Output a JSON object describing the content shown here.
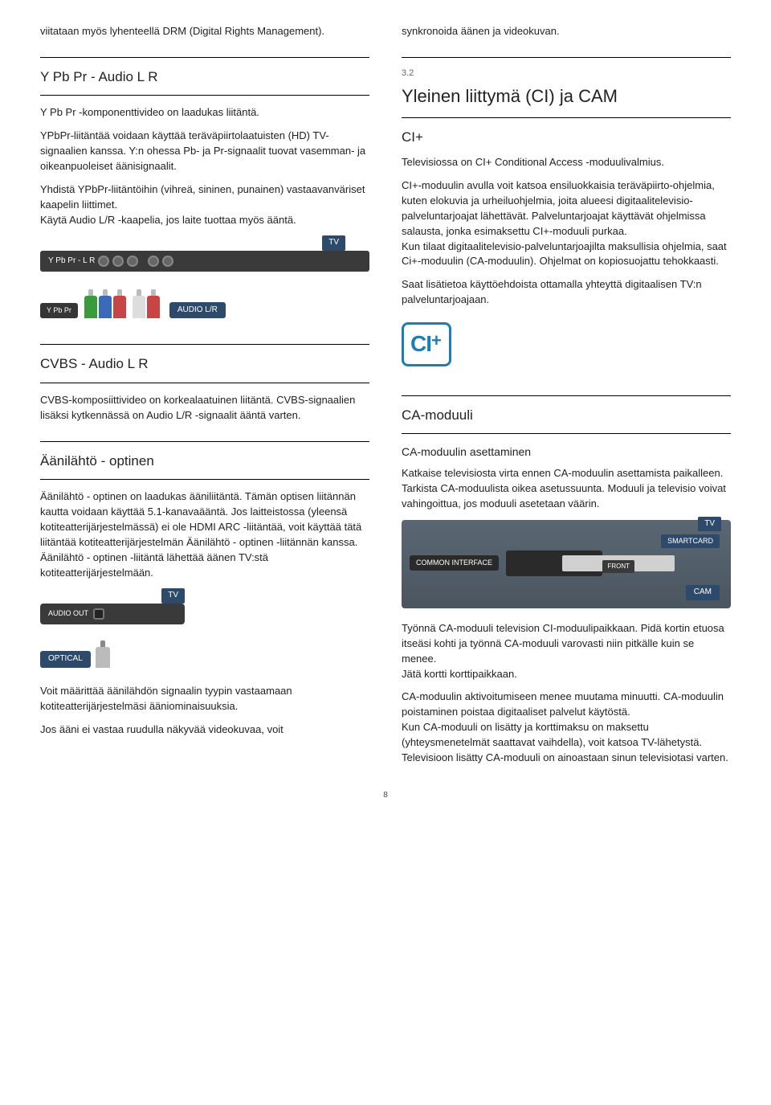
{
  "left": {
    "intro_drm": "viitataan myös lyhenteellä DRM (Digital Rights Management).",
    "ypbpr_title": "Y Pb Pr - Audio L R",
    "ypbpr_p1": "Y Pb Pr -komponenttivideo on laadukas liitäntä.",
    "ypbpr_p2": "YPbPr-liitäntää voidaan käyttää teräväpiirtolaatuisten (HD) TV-signaalien kanssa. Y:n ohessa Pb- ja Pr-signaalit tuovat vasemman- ja oikeanpuoleiset äänisignaalit.",
    "ypbpr_p3": "Yhdistä YPbPr-liitäntöihin (vihreä, sininen, punainen) vastaavanväriset kaapelin liittimet.\nKäytä Audio L/R -kaapelia, jos laite tuottaa myös ääntä.",
    "diag_tv": "TV",
    "diag_ypbpr_lr": "Y Pb Pr - L R",
    "diag_ypbpr": "Y Pb Pr",
    "diag_audiolr": "AUDIO L/R",
    "cvbs_title": "CVBS - Audio L R",
    "cvbs_p": "CVBS-komposiittivideo on korkealaatuinen liitäntä. CVBS-signaalien lisäksi kytkennässä on Audio L/R -signaalit ääntä varten.",
    "optical_title": "Äänilähtö - optinen",
    "optical_p": "Äänilähtö - optinen on laadukas ääniliitäntä. Tämän optisen liitännän kautta voidaan käyttää 5.1-kanavaääntä. Jos laitteistossa (yleensä kotiteatterijärjestelmässä) ei ole HDMI ARC -liitäntää, voit käyttää tätä liitäntää kotiteatterijärjestelmän Äänilähtö - optinen -liitännän kanssa. Äänilähtö - optinen -liitäntä lähettää äänen TV:stä kotiteatterijärjestelmään.",
    "diag_audio_out": "AUDIO OUT",
    "diag_optical": "OPTICAL",
    "optical_p2": "Voit määrittää äänilähdön signaalin tyypin vastaamaan kotiteatterijärjestelmäsi ääniominaisuuksia.",
    "optical_p3": "Jos ääni ei vastaa ruudulla näkyvää videokuvaa, voit"
  },
  "right": {
    "sync_p": "synkronoida äänen ja videokuvan.",
    "num": "3.2",
    "ci_title": "Yleinen liittymä (CI) ja CAM",
    "ciplus_heading": "CI+",
    "ciplus_p1": "Televisiossa on CI+ Conditional Access -moduulivalmius.",
    "ciplus_p2": "CI+-moduulin avulla voit katsoa ensiluokkaisia teräväpiirto-ohjelmia, kuten elokuvia ja urheiluohjelmia, joita alueesi digitaalitelevisio-palveluntarjoajat lähettävät. Palveluntarjoajat käyttävät ohjelmissa salausta, jonka esimaksettu CI+-moduuli purkaa.\nKun tilaat digitaalitelevisio-palveluntarjoajilta maksullisia ohjelmia, saat Ci+-moduulin (CA-moduulin). Ohjelmat on kopiosuojattu tehokkaasti.",
    "ciplus_p3": "Saat lisätietoa käyttöehdoista ottamalla yhteyttä digitaalisen TV:n palveluntarjoajaan.",
    "ciplus_logo": "CI",
    "ciplus_logo_plus": "+",
    "ca_title": "CA-moduuli",
    "ca_sub": "CA-moduulin asettaminen",
    "ca_p1": "Katkaise televisiosta virta ennen CA-moduulin asettamista paikalleen.\nTarkista CA-moduulista oikea asetussuunta. Moduuli ja televisio voivat vahingoittua, jos moduuli asetetaan väärin.",
    "cam_tv": "TV",
    "cam_ci": "COMMON INTERFACE",
    "cam_smart": "SMARTCARD",
    "cam_front": "FRONT",
    "cam_cam": "CAM",
    "ca_p2": "Työnnä CA-moduuli television CI-moduulipaikkaan. Pidä kortin etuosa itseäsi kohti ja työnnä CA-moduuli varovasti niin pitkälle kuin se menee.\nJätä kortti korttipaikkaan.",
    "ca_p3": "CA-moduulin aktivoitumiseen menee muutama minuutti. CA-moduulin poistaminen poistaa digitaaliset palvelut käytöstä.\nKun CA-moduuli on lisätty ja korttimaksu on maksettu (yhteysmenetelmät saattavat vaihdella), voit katsoa TV-lähetystä. Televisioon lisätty CA-moduuli on ainoastaan sinun televisiotasi varten."
  },
  "page_number": "8"
}
